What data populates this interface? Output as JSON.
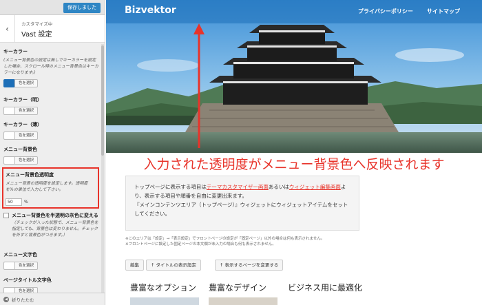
{
  "sidebar": {
    "save_label": "保存しました",
    "subtitle": "カスタマイズ中",
    "title": "Vast 設定",
    "back_icon": "chevron-left-icon",
    "key_color": {
      "title": "キーカラー",
      "desc": "(メニュー背景色の設定は無しでキーカラーを設定した場合、スクロール時のメニュー背景色はキーカラーになります。)",
      "button": "色を選択",
      "swatch": "#1d6fb8"
    },
    "key_color_light": {
      "title": "キーカラー（明）",
      "button": "色を選択"
    },
    "key_color_dark": {
      "title": "キーカラー（薄）",
      "button": "色を選択"
    },
    "menu_bg": {
      "title": "メニュー背景色",
      "button": "色を選択"
    },
    "menu_opacity": {
      "title": "メニュー背景色透明度",
      "desc": "メニュー背景の透明度を設定します。透明度を%の単位で入力して下さい。",
      "value": "50",
      "unit": "%"
    },
    "menu_gray": {
      "label": "メニュー背景色を半透明の灰色に変える",
      "desc": "（チェックが入った状態で、メニュー背景色を指定しても、背景色は変わりません。チェックを外すと背景色がつきます。）"
    },
    "menu_text": {
      "title": "メニュー文字色",
      "button": "色を選択"
    },
    "page_title_color": {
      "title": "ページタイトル文字色",
      "button": "色を選択"
    },
    "collapse_label": "折りたたむ"
  },
  "preview": {
    "logo": "Bizvektor",
    "nav": [
      "プライバシーポリシー",
      "サイトマップ"
    ],
    "annotation": "入力された透明度がメニュー背景色へ反映されます",
    "notice": {
      "line1_pre": "トップページに表示する項目は",
      "link1": "テーマカスタマイザー画面",
      "line1_mid": "あるいは",
      "link2": "ウィジェット編集画面",
      "line2": "より、表示する項目や順番を自由に変更出来ます。",
      "line3": "『メインコンテンツエリア（トップページ）』ウィジェットにウィジェットアイテムをセットしてください。"
    },
    "small_notes": [
      "※このエリアは「設定」→「表示設定」でフロントページの設定が「固定ページ」以外の場合は何も表示されません。",
      "※フロントページに設定した固定ページの本文欄が未入力の場合も何も表示されません。"
    ],
    "buttons": [
      "編集",
      "↑ タイトルの表示設定",
      "↑ 表示するページを変更する"
    ],
    "features": [
      "豊富なオプション",
      "豊富なデザイン",
      "ビジネス用に最適化"
    ],
    "colors": {
      "accent": "#e8332a",
      "brand": "#2f86c4"
    }
  }
}
